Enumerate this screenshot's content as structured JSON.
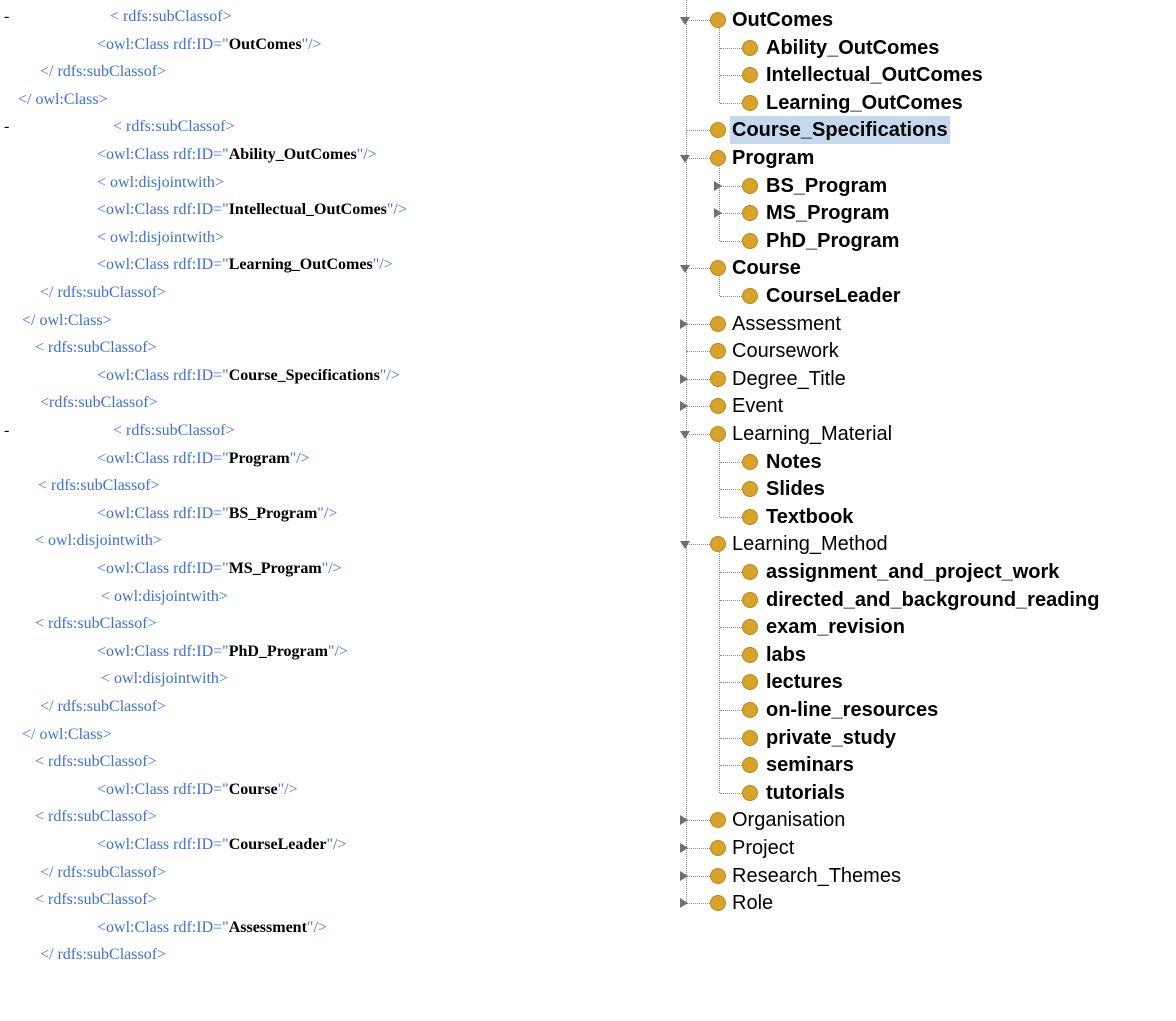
{
  "colors": {
    "xml_tag": "#3f6fd1",
    "node_dot": "#d8a32a",
    "selection": "#c5d9ee"
  },
  "xml": {
    "lines": [
      {
        "gutter": "-",
        "pre": "< rdfs:subClassof>",
        "id": "",
        "post": ""
      },
      {
        "gutter": "",
        "pre": "<owl:Class rdf:ID=",
        "id": "OutComes",
        "post": "/>"
      },
      {
        "gutter": "",
        "pre": "</ rdfs:subClassof>",
        "id": "",
        "post": ""
      },
      {
        "gutter": "",
        "pre": "</ owl:Class>",
        "id": "",
        "post": ""
      },
      {
        "gutter": "-",
        "pre": "< rdfs:subClassof>",
        "id": "",
        "post": ""
      },
      {
        "gutter": "",
        "pre": "<owl:Class rdf:ID=",
        "id": "Ability_OutComes",
        "post": "/>"
      },
      {
        "gutter": "",
        "pre": "< owl:disjointwith>",
        "id": "",
        "post": ""
      },
      {
        "gutter": "",
        "pre": "<owl:Class rdf:ID=",
        "id": "Intellectual_OutComes",
        "post": "/>"
      },
      {
        "gutter": "",
        "pre": "< owl:disjointwith>",
        "id": "",
        "post": ""
      },
      {
        "gutter": "",
        "pre": "<owl:Class rdf:ID=",
        "id": "Learning_OutComes",
        "post": "/>"
      },
      {
        "gutter": "",
        "pre": "</ rdfs:subClassof>",
        "id": "",
        "post": ""
      },
      {
        "gutter": "",
        "pre": "</ owl:Class>",
        "id": "",
        "post": ""
      },
      {
        "gutter": "",
        "pre": "< rdfs:subClassof>",
        "id": "",
        "post": ""
      },
      {
        "gutter": "",
        "pre": "<owl:Class rdf:ID=",
        "id": "Course_Specifications",
        "post": "/>"
      },
      {
        "gutter": "",
        "pre": "<rdfs:subClassof>",
        "id": "",
        "post": ""
      },
      {
        "gutter": "-",
        "pre": "< rdfs:subClassof>",
        "id": "",
        "post": ""
      },
      {
        "gutter": "",
        "pre": "<owl:Class rdf:ID=",
        "id": "Program",
        "post": "/>"
      },
      {
        "gutter": "",
        "pre": "< rdfs:subClassof>",
        "id": "",
        "post": ""
      },
      {
        "gutter": "",
        "pre": "<owl:Class rdf:ID=",
        "id": "BS_Program",
        "post": "/>"
      },
      {
        "gutter": "",
        "pre": "< owl:disjointwith>",
        "id": "",
        "post": ""
      },
      {
        "gutter": "",
        "pre": "<owl:Class rdf:ID=",
        "id": "MS_Program",
        "post": "/>"
      },
      {
        "gutter": "",
        "pre": "< owl:disjointwith>",
        "id": "",
        "post": ""
      },
      {
        "gutter": "",
        "pre": "< rdfs:subClassof>",
        "id": "",
        "post": ""
      },
      {
        "gutter": "",
        "pre": "<owl:Class rdf:ID=",
        "id": "PhD_Program",
        "post": "/>"
      },
      {
        "gutter": "",
        "pre": "< owl:disjointwith>",
        "id": "",
        "post": ""
      },
      {
        "gutter": "",
        "pre": "</ rdfs:subClassof>",
        "id": "",
        "post": ""
      },
      {
        "gutter": "",
        "pre": "</ owl:Class>",
        "id": "",
        "post": ""
      },
      {
        "gutter": "",
        "pre": "< rdfs:subClassof>",
        "id": "",
        "post": ""
      },
      {
        "gutter": "",
        "pre": "<owl:Class rdf:ID=",
        "id": "Course",
        "post": "/>"
      },
      {
        "gutter": "",
        "pre": "< rdfs:subClassof>",
        "id": "",
        "post": ""
      },
      {
        "gutter": "",
        "pre": "<owl:Class rdf:ID=",
        "id": "CourseLeader",
        "post": "/>"
      },
      {
        "gutter": "",
        "pre": "</ rdfs:subClassof>",
        "id": "",
        "post": ""
      },
      {
        "gutter": "",
        "pre": "< rdfs:subClassof>",
        "id": "",
        "post": ""
      },
      {
        "gutter": "",
        "pre": "<owl:Class rdf:ID=",
        "id": "Assessment",
        "post": "/>"
      },
      {
        "gutter": "",
        "pre": "</ rdfs:subClassof>",
        "id": "",
        "post": ""
      }
    ]
  },
  "tree": {
    "nodes": [
      {
        "label": "OutComes",
        "level": 0,
        "expander": "open",
        "bold": true,
        "selected": false
      },
      {
        "label": "Ability_OutComes",
        "level": 1,
        "expander": "none",
        "bold": true,
        "selected": false
      },
      {
        "label": "Intellectual_OutComes",
        "level": 1,
        "expander": "none",
        "bold": true,
        "selected": false
      },
      {
        "label": "Learning_OutComes",
        "level": 1,
        "expander": "none",
        "bold": true,
        "selected": false
      },
      {
        "label": "Course_Specifications",
        "level": 0,
        "expander": "none",
        "bold": true,
        "selected": true
      },
      {
        "label": "Program",
        "level": 0,
        "expander": "open",
        "bold": true,
        "selected": false
      },
      {
        "label": "BS_Program",
        "level": 1,
        "expander": "closed",
        "bold": true,
        "selected": false
      },
      {
        "label": "MS_Program",
        "level": 1,
        "expander": "closed",
        "bold": true,
        "selected": false
      },
      {
        "label": "PhD_Program",
        "level": 1,
        "expander": "none",
        "bold": true,
        "selected": false
      },
      {
        "label": "Course",
        "level": 0,
        "expander": "open",
        "bold": true,
        "selected": false
      },
      {
        "label": "CourseLeader",
        "level": 1,
        "expander": "none",
        "bold": true,
        "selected": false
      },
      {
        "label": "Assessment",
        "level": 0,
        "expander": "closed",
        "bold": false,
        "selected": false
      },
      {
        "label": "Coursework",
        "level": 0,
        "expander": "none",
        "bold": false,
        "selected": false
      },
      {
        "label": "Degree_Title",
        "level": 0,
        "expander": "closed",
        "bold": false,
        "selected": false
      },
      {
        "label": "Event",
        "level": 0,
        "expander": "closed",
        "bold": false,
        "selected": false
      },
      {
        "label": "Learning_Material",
        "level": 0,
        "expander": "open",
        "bold": false,
        "selected": false
      },
      {
        "label": "Notes",
        "level": 1,
        "expander": "none",
        "bold": true,
        "selected": false
      },
      {
        "label": "Slides",
        "level": 1,
        "expander": "none",
        "bold": true,
        "selected": false
      },
      {
        "label": "Textbook",
        "level": 1,
        "expander": "none",
        "bold": true,
        "selected": false
      },
      {
        "label": "Learning_Method",
        "level": 0,
        "expander": "open",
        "bold": false,
        "selected": false
      },
      {
        "label": "assignment_and_project_work",
        "level": 1,
        "expander": "none",
        "bold": true,
        "selected": false
      },
      {
        "label": "directed_and_background_reading",
        "level": 1,
        "expander": "none",
        "bold": true,
        "selected": false
      },
      {
        "label": "exam_revision",
        "level": 1,
        "expander": "none",
        "bold": true,
        "selected": false
      },
      {
        "label": "labs",
        "level": 1,
        "expander": "none",
        "bold": true,
        "selected": false
      },
      {
        "label": "lectures",
        "level": 1,
        "expander": "none",
        "bold": true,
        "selected": false
      },
      {
        "label": "on-line_resources",
        "level": 1,
        "expander": "none",
        "bold": true,
        "selected": false
      },
      {
        "label": "private_study",
        "level": 1,
        "expander": "none",
        "bold": true,
        "selected": false
      },
      {
        "label": "seminars",
        "level": 1,
        "expander": "none",
        "bold": true,
        "selected": false
      },
      {
        "label": "tutorials",
        "level": 1,
        "expander": "none",
        "bold": true,
        "selected": false
      },
      {
        "label": "Organisation",
        "level": 0,
        "expander": "closed",
        "bold": false,
        "selected": false
      },
      {
        "label": "Project",
        "level": 0,
        "expander": "closed",
        "bold": false,
        "selected": false
      },
      {
        "label": "Research_Themes",
        "level": 0,
        "expander": "closed",
        "bold": false,
        "selected": false
      },
      {
        "label": "Role",
        "level": 0,
        "expander": "closed",
        "bold": false,
        "selected": false
      }
    ]
  }
}
